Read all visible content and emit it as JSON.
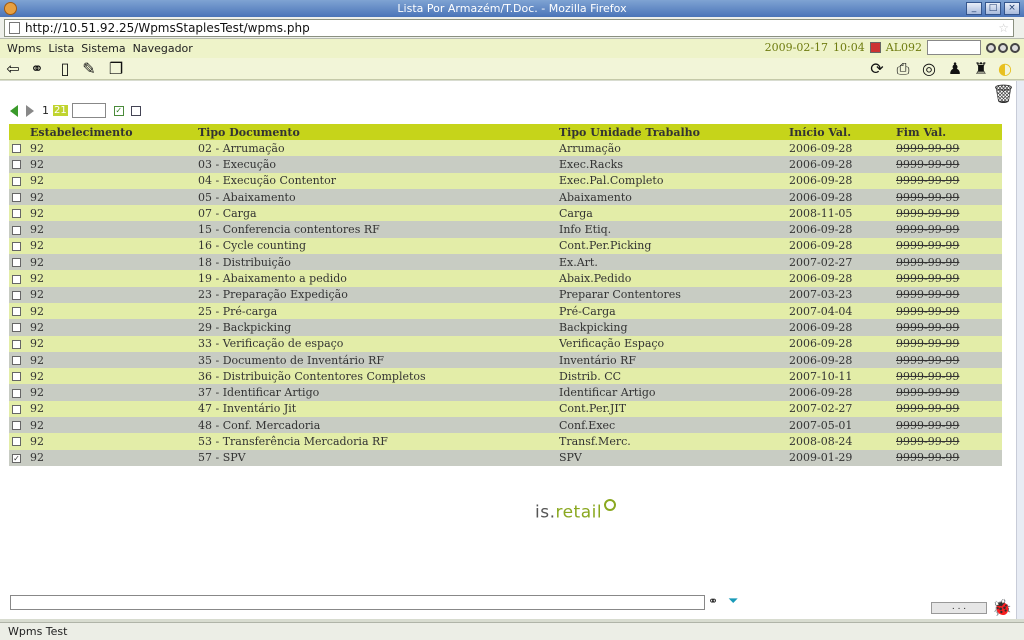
{
  "window": {
    "title": "Lista Por Armazém/T.Doc. - Mozilla Firefox",
    "controls": [
      "_",
      "□",
      "×"
    ]
  },
  "browser": {
    "url": "http://10.51.92.25/WpmsStaplesTest/wpms.php"
  },
  "menu": {
    "items": [
      "Wpms",
      "Lista",
      "Sistema",
      "Navegador"
    ],
    "date": "2009-02-17",
    "time": "10:04",
    "user": "AL092"
  },
  "pagination": {
    "page": "1",
    "total": "21"
  },
  "table": {
    "headers": [
      "Estabelecimento",
      "Tipo Documento",
      "Tipo Unidade Trabalho",
      "Início Val.",
      "Fim Val."
    ],
    "rows": [
      {
        "checked": false,
        "estab": "92",
        "tipo": "02 - Arrumação",
        "unidade": "Arrumação",
        "inicio": "2006-09-28",
        "fim": "9999-99-99"
      },
      {
        "checked": false,
        "estab": "92",
        "tipo": "03 - Execução",
        "unidade": "Exec.Racks",
        "inicio": "2006-09-28",
        "fim": "9999-99-99"
      },
      {
        "checked": false,
        "estab": "92",
        "tipo": "04 - Execução Contentor",
        "unidade": "Exec.Pal.Completo",
        "inicio": "2006-09-28",
        "fim": "9999-99-99"
      },
      {
        "checked": false,
        "estab": "92",
        "tipo": "05 - Abaixamento",
        "unidade": "Abaixamento",
        "inicio": "2006-09-28",
        "fim": "9999-99-99"
      },
      {
        "checked": false,
        "estab": "92",
        "tipo": "07 - Carga",
        "unidade": "Carga",
        "inicio": "2008-11-05",
        "fim": "9999-99-99"
      },
      {
        "checked": false,
        "estab": "92",
        "tipo": "15 - Conferencia contentores RF",
        "unidade": "Info Etiq.",
        "inicio": "2006-09-28",
        "fim": "9999-99-99"
      },
      {
        "checked": false,
        "estab": "92",
        "tipo": "16 - Cycle counting",
        "unidade": "Cont.Per.Picking",
        "inicio": "2006-09-28",
        "fim": "9999-99-99"
      },
      {
        "checked": false,
        "estab": "92",
        "tipo": "18 - Distribuição",
        "unidade": "Ex.Art.",
        "inicio": "2007-02-27",
        "fim": "9999-99-99"
      },
      {
        "checked": false,
        "estab": "92",
        "tipo": "19 - Abaixamento a pedido",
        "unidade": "Abaix.Pedido",
        "inicio": "2006-09-28",
        "fim": "9999-99-99"
      },
      {
        "checked": false,
        "estab": "92",
        "tipo": "23 - Preparação Expedição",
        "unidade": "Preparar Contentores",
        "inicio": "2007-03-23",
        "fim": "9999-99-99"
      },
      {
        "checked": false,
        "estab": "92",
        "tipo": "25 - Pré-carga",
        "unidade": "Pré-Carga",
        "inicio": "2007-04-04",
        "fim": "9999-99-99"
      },
      {
        "checked": false,
        "estab": "92",
        "tipo": "29 - Backpicking",
        "unidade": "Backpicking",
        "inicio": "2006-09-28",
        "fim": "9999-99-99"
      },
      {
        "checked": false,
        "estab": "92",
        "tipo": "33 - Verificação de espaço",
        "unidade": "Verificação Espaço",
        "inicio": "2006-09-28",
        "fim": "9999-99-99"
      },
      {
        "checked": false,
        "estab": "92",
        "tipo": "35 - Documento de Inventário RF",
        "unidade": "Inventário RF",
        "inicio": "2006-09-28",
        "fim": "9999-99-99"
      },
      {
        "checked": false,
        "estab": "92",
        "tipo": "36 - Distribuição Contentores Completos",
        "unidade": "Distrib. CC",
        "inicio": "2007-10-11",
        "fim": "9999-99-99"
      },
      {
        "checked": false,
        "estab": "92",
        "tipo": "37 - Identificar Artigo",
        "unidade": "Identificar Artigo",
        "inicio": "2006-09-28",
        "fim": "9999-99-99"
      },
      {
        "checked": false,
        "estab": "92",
        "tipo": "47 - Inventário Jit",
        "unidade": "Cont.Per.JIT",
        "inicio": "2007-02-27",
        "fim": "9999-99-99"
      },
      {
        "checked": false,
        "estab": "92",
        "tipo": "48 - Conf. Mercadoria",
        "unidade": "Conf.Exec",
        "inicio": "2007-05-01",
        "fim": "9999-99-99"
      },
      {
        "checked": false,
        "estab": "92",
        "tipo": "53 - Transferência Mercadoria RF",
        "unidade": "Transf.Merc.",
        "inicio": "2008-08-24",
        "fim": "9999-99-99"
      },
      {
        "checked": true,
        "estab": "92",
        "tipo": "57 - SPV",
        "unidade": "SPV",
        "inicio": "2009-01-29",
        "fim": "9999-99-99"
      }
    ]
  },
  "logo": {
    "prefix": "is.",
    "suffix": "retail"
  },
  "bottom": {
    "dots": ". . ."
  },
  "status": {
    "text": "Wpms Test"
  }
}
